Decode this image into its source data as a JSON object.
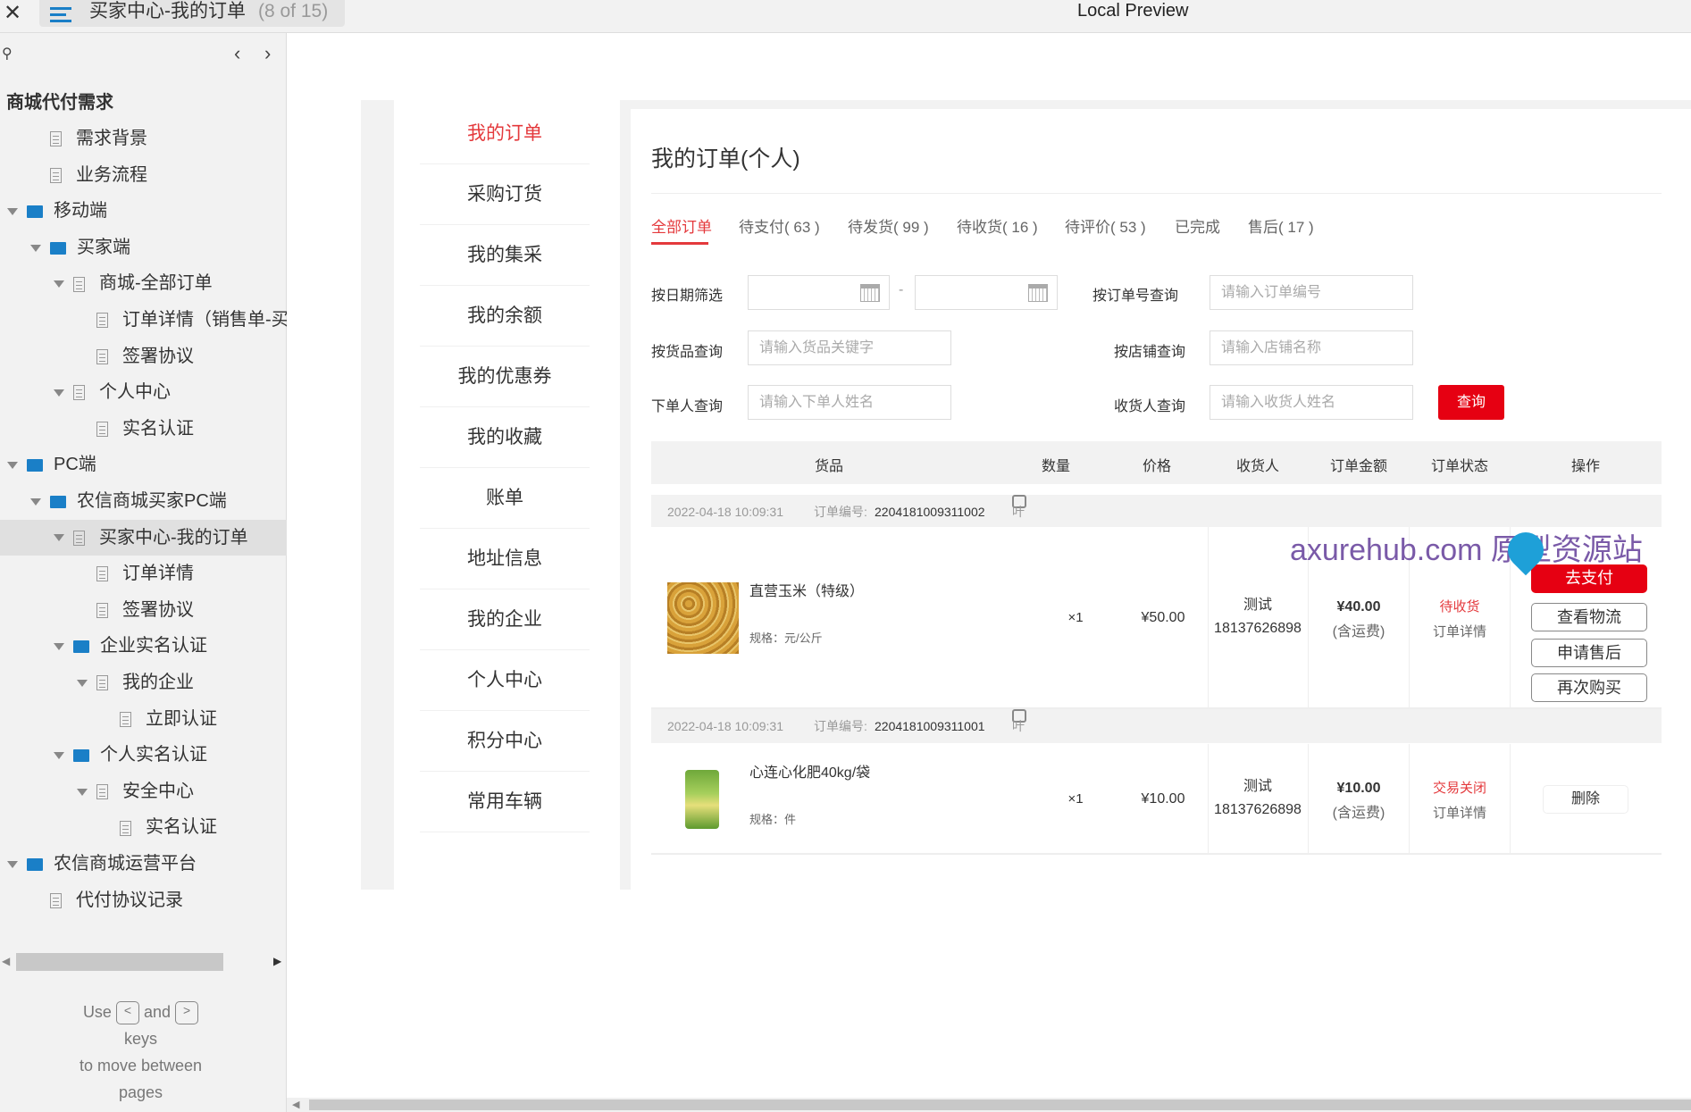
{
  "topbar": {
    "close": "✕",
    "page_title": "买家中心-我的订单",
    "page_count": "(8 of 15)",
    "app_title": "Local Preview"
  },
  "sidebar": {
    "project": "商城代付需求",
    "items": [
      {
        "label": "需求背景",
        "type": "page",
        "level": 1
      },
      {
        "label": "业务流程",
        "type": "page",
        "level": 1
      },
      {
        "label": "移动端",
        "type": "folder",
        "level": 0,
        "expanded": true
      },
      {
        "label": "买家端",
        "type": "folder",
        "level": 1,
        "expanded": true
      },
      {
        "label": "商城-全部订单",
        "type": "page",
        "level": 2,
        "expanded": true
      },
      {
        "label": "订单详情（销售单-买",
        "type": "page",
        "level": 3
      },
      {
        "label": "签署协议",
        "type": "page",
        "level": 3
      },
      {
        "label": "个人中心",
        "type": "page",
        "level": 2,
        "expanded": true
      },
      {
        "label": "实名认证",
        "type": "page",
        "level": 3
      },
      {
        "label": "PC端",
        "type": "folder",
        "level": 0,
        "expanded": true
      },
      {
        "label": "农信商城买家PC端",
        "type": "folder",
        "level": 1,
        "expanded": true
      },
      {
        "label": "买家中心-我的订单",
        "type": "page",
        "level": 2,
        "expanded": true,
        "selected": true
      },
      {
        "label": "订单详情",
        "type": "page",
        "level": 3
      },
      {
        "label": "签署协议",
        "type": "page",
        "level": 3
      },
      {
        "label": "企业实名认证",
        "type": "folder",
        "level": 2,
        "expanded": true
      },
      {
        "label": "我的企业",
        "type": "page",
        "level": 3,
        "expanded": true
      },
      {
        "label": "立即认证",
        "type": "page",
        "level": 4
      },
      {
        "label": "个人实名认证",
        "type": "folder",
        "level": 2,
        "expanded": true
      },
      {
        "label": "安全中心",
        "type": "page",
        "level": 3,
        "expanded": true
      },
      {
        "label": "实名认证",
        "type": "page",
        "level": 4
      },
      {
        "label": "农信商城运营平台",
        "type": "folder",
        "level": 0,
        "expanded": true
      },
      {
        "label": "代付协议记录",
        "type": "page",
        "level": 1
      }
    ],
    "help": {
      "use": "Use",
      "key_prev": "<",
      "and": "and",
      "key_next": ">",
      "rest1": "keys",
      "rest2": "to move between",
      "rest3": "pages"
    }
  },
  "menu": {
    "items": [
      "我的订单",
      "采购订货",
      "我的集采",
      "我的余额",
      "我的优惠券",
      "我的收藏",
      "账单",
      "地址信息",
      "我的企业",
      "个人中心",
      "积分中心",
      "常用车辆"
    ],
    "active": 0
  },
  "main": {
    "title": "我的订单(个人)",
    "tabs": [
      "全部订单",
      "待支付( 63 )",
      "待发货( 99 )",
      "待收货( 16 )",
      "待评价( 53 )",
      "已完成",
      "售后( 17 )"
    ],
    "filters": {
      "date_label": "按日期筛选",
      "date_sep": "-",
      "order_no_label": "按订单号查询",
      "order_no_ph": "请输入订单编号",
      "goods_label": "按货品查询",
      "goods_ph": "请输入货品关键字",
      "store_label": "按店铺查询",
      "store_ph": "请输入店铺名称",
      "buyer_label": "下单人查询",
      "buyer_ph": "请输入下单人姓名",
      "receiver_label": "收货人查询",
      "receiver_ph": "请输入收货人姓名",
      "query": "查询"
    },
    "columns": [
      "货品",
      "数量",
      "价格",
      "收货人",
      "订单金额",
      "订单状态",
      "操作"
    ],
    "orders": [
      {
        "time": "2022-04-18 10:09:31",
        "no_label": "订单编号:",
        "no": "2204181009311002",
        "store": "叶子店铺",
        "product": "直营玉米（特级）",
        "spec": "规格：元/公斤",
        "qty": "×1",
        "price": "¥50.00",
        "receiver": "测试",
        "phone": "18137626898",
        "amount": "¥40.00",
        "freight": "(含运费)",
        "status": "待收货",
        "detail": "订单详情",
        "actions": [
          "去支付",
          "查看物流",
          "申请售后",
          "再次购买"
        ]
      },
      {
        "time": "2022-04-18 10:09:31",
        "no_label": "订单编号:",
        "no": "2204181009311001",
        "store": "叶子店铺",
        "product": "心连心化肥40kg/袋",
        "spec": "规格：件",
        "qty": "×1",
        "price": "¥10.00",
        "receiver": "测试",
        "phone": "18137626898",
        "amount": "¥10.00",
        "freight": "(含运费)",
        "status": "交易关闭",
        "detail": "订单详情",
        "actions": [
          "删除"
        ]
      }
    ]
  },
  "watermark": "axurehub.com 原型资源站",
  "colors": {
    "accent": "#e4393c",
    "pay_button": "#e60012",
    "folder": "#1a7fc7"
  }
}
